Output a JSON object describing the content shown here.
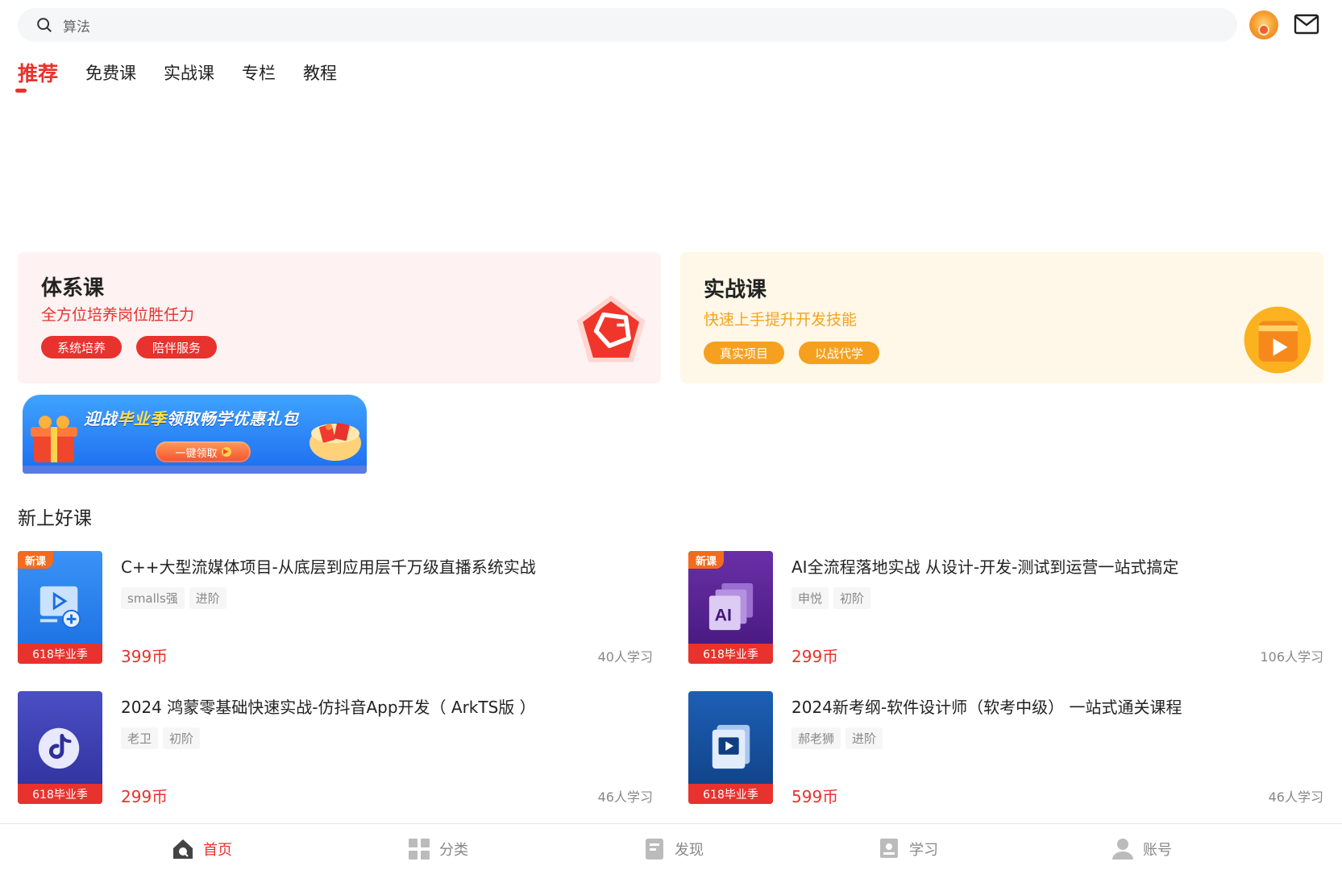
{
  "search": {
    "placeholder": "算法"
  },
  "tabs": [
    "推荐",
    "免费课",
    "实战课",
    "专栏",
    "教程"
  ],
  "categories": {
    "system": {
      "title": "体系课",
      "subtitle": "全方位培养岗位胜任力",
      "tags": [
        "系统培养",
        "陪伴服务"
      ]
    },
    "practical": {
      "title": "实战课",
      "subtitle": "快速上手提升开发技能",
      "tags": [
        "真实项目",
        "以战代学"
      ]
    }
  },
  "promo": {
    "text_prefix": "迎战",
    "text_highlight": "毕业季",
    "text_suffix": "领取畅学优惠礼包",
    "button": "一键领取"
  },
  "section_title": "新上好课",
  "courses": [
    {
      "title": "C++大型流媒体项目-从底层到应用层千万级直播系统实战",
      "author": "smalls强",
      "level": "进阶",
      "price": "399币",
      "learners": "40人学习",
      "badge": "新课",
      "band": "618毕业季",
      "cover_color": "#1f7ce8"
    },
    {
      "title": "AI全流程落地实战  从设计-开发-测试到运营一站式搞定",
      "author": "申悦",
      "level": "初阶",
      "price": "299币",
      "learners": "106人学习",
      "badge": "新课",
      "band": "618毕业季",
      "cover_color": "#5b2596"
    },
    {
      "title": "2024 鸿蒙零基础快速实战-仿抖音App开发（ ArkTS版 ）",
      "author": "老卫",
      "level": "初阶",
      "price": "299币",
      "learners": "46人学习",
      "badge": "",
      "band": "618毕业季",
      "cover_color": "#3a3fb3"
    },
    {
      "title": "2024新考纲-软件设计师（软考中级）  一站式通关课程",
      "author": "郝老狮",
      "level": "进阶",
      "price": "599币",
      "learners": "46人学习",
      "badge": "",
      "band": "618毕业季",
      "cover_color": "#16509e"
    }
  ],
  "bottom_nav": [
    "首页",
    "分类",
    "发现",
    "学习",
    "账号"
  ],
  "colors": {
    "accent": "#e8322d",
    "orange": "#f6a01f"
  }
}
